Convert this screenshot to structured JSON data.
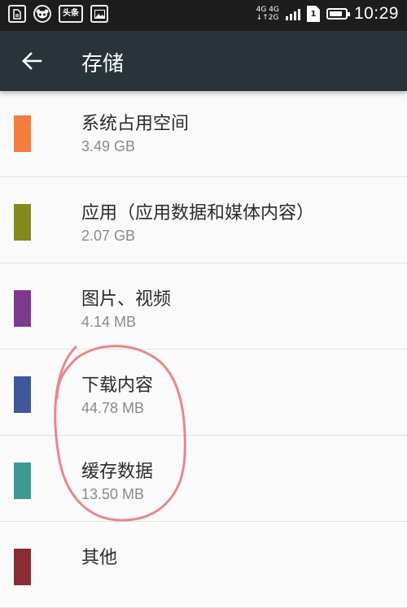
{
  "status_bar": {
    "app_icons": [
      {
        "icon": "document-icon",
        "text": ""
      },
      {
        "icon": "panda-icon",
        "text": ""
      },
      {
        "icon": "toutiao-icon",
        "text": "头条"
      },
      {
        "icon": "image-icon",
        "text": ""
      }
    ],
    "network_top": "4G 4G",
    "network_bottom": "↓↑2G",
    "sim_label": "1",
    "battery_level": 0.85,
    "time": "10:29"
  },
  "app_bar": {
    "back_icon": "arrow-left-icon",
    "title": "存储"
  },
  "storage_items": [
    {
      "name": "系统占用空间",
      "size": "3.49 GB",
      "color": "#f47d3e"
    },
    {
      "name": "应用（应用数据和媒体内容）",
      "size": "2.07 GB",
      "color": "#828a1e"
    },
    {
      "name": "图片、视频",
      "size": "4.14 MB",
      "color": "#7e3a8e"
    },
    {
      "name": "下载内容",
      "size": "44.78 MB",
      "color": "#40589a"
    },
    {
      "name": "缓存数据",
      "size": "13.50 MB",
      "color": "#3d9a92"
    },
    {
      "name": "其他",
      "size": "",
      "color": "#8a2c34"
    }
  ],
  "annotation_color": "#e8868a"
}
